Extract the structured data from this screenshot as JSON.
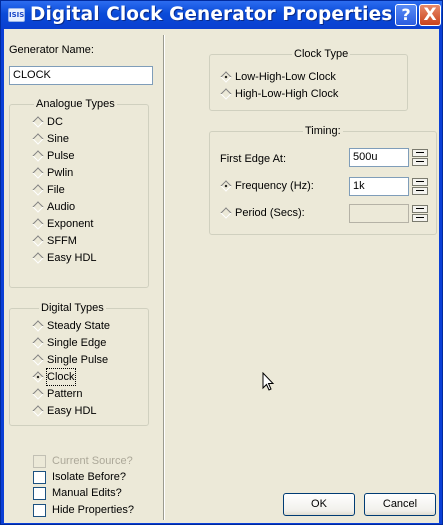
{
  "window": {
    "icon_label": "ISIS",
    "title": "Digital Clock Generator Properties",
    "help_button": "?",
    "close_button": "X"
  },
  "generator_name": {
    "label": "Generator Name:",
    "value": "CLOCK"
  },
  "analogue_types": {
    "title": "Analogue Types",
    "items": [
      "DC",
      "Sine",
      "Pulse",
      "Pwlin",
      "File",
      "Audio",
      "Exponent",
      "SFFM",
      "Easy HDL"
    ]
  },
  "digital_types": {
    "title": "Digital Types",
    "items": [
      "Steady State",
      "Single Edge",
      "Single Pulse",
      "Clock",
      "Pattern",
      "Easy HDL"
    ],
    "selected": "Clock"
  },
  "checkboxes": {
    "current_source": "Current Source?",
    "isolate_before": "Isolate Before?",
    "manual_edits": "Manual Edits?",
    "hide_properties": "Hide Properties?"
  },
  "clock_type": {
    "title": "Clock Type",
    "options": [
      "Low-High-Low Clock",
      "High-Low-High Clock"
    ],
    "selected": "Low-High-Low Clock"
  },
  "timing": {
    "title": "Timing:",
    "first_edge_label": "First Edge At:",
    "first_edge_value": "500u",
    "frequency_label": "Frequency (Hz):",
    "frequency_value": "1k",
    "period_label": "Period (Secs):",
    "period_value": "",
    "selected": "Frequency (Hz):"
  },
  "buttons": {
    "ok": "OK",
    "cancel": "Cancel"
  }
}
